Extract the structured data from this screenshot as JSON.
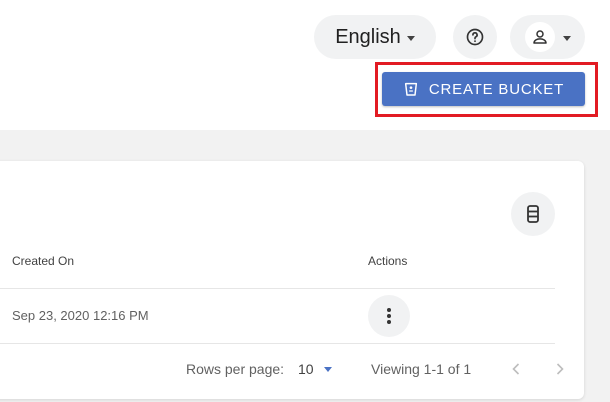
{
  "header": {
    "language": "English"
  },
  "toolbar": {
    "create_label": "CREATE BUCKET"
  },
  "table": {
    "columns": [
      "Created On",
      "Actions"
    ],
    "rows": [
      {
        "created_on": "Sep 23, 2020 12:16 PM"
      }
    ]
  },
  "pagination": {
    "rows_per_page_label": "Rows per page:",
    "rows_per_page_value": "10",
    "viewing": "Viewing 1-1 of 1"
  },
  "colors": {
    "accent": "#4a72c4",
    "highlight": "#e21b23",
    "pill_bg": "#f1f2f3"
  },
  "icons": {
    "help": "help-circle-icon",
    "user": "person-icon",
    "bucket": "bucket-icon",
    "columns": "columns-icon",
    "actions": "kebab-icon",
    "prev": "chevron-left-icon",
    "next": "chevron-right-icon"
  }
}
